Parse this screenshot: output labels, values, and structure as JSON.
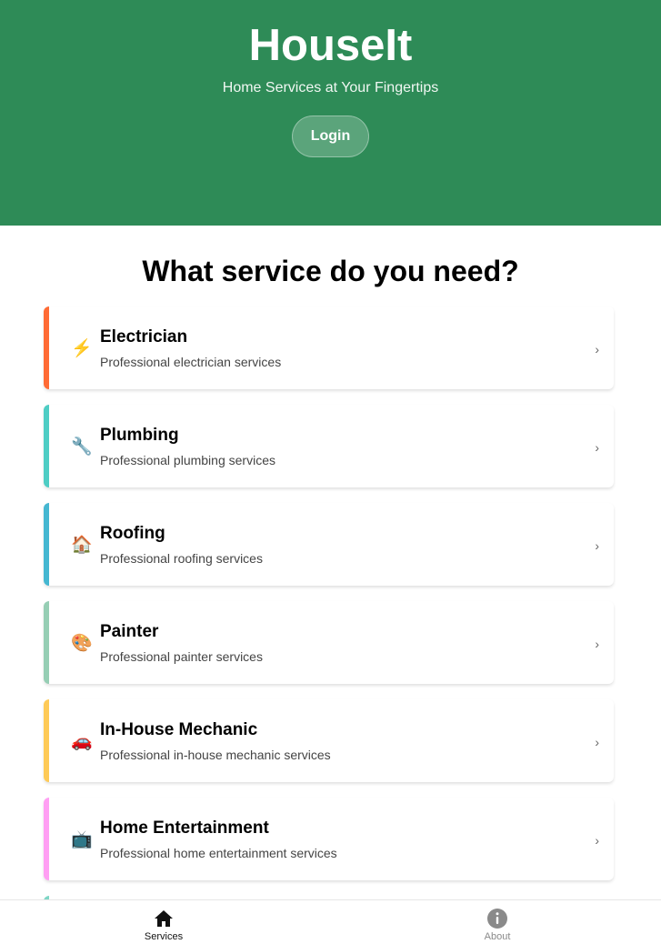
{
  "header": {
    "title": "HouseIt",
    "tagline": "Home Services at Your Fingertips",
    "login_label": "Login"
  },
  "main": {
    "section_title": "What service do you need?",
    "services": [
      {
        "name": "Electrician",
        "description": "Professional electrician services",
        "icon": "⚡",
        "icon_name": "lightning-icon",
        "accent": "#ff6b35"
      },
      {
        "name": "Plumbing",
        "description": "Professional plumbing services",
        "icon": "🔧",
        "icon_name": "wrench-icon",
        "accent": "#4ecdc4"
      },
      {
        "name": "Roofing",
        "description": "Professional roofing services",
        "icon": "🏠",
        "icon_name": "house-icon",
        "accent": "#45b7d1"
      },
      {
        "name": "Painter",
        "description": "Professional painter services",
        "icon": "🎨",
        "icon_name": "palette-icon",
        "accent": "#96ceb4"
      },
      {
        "name": "In-House Mechanic",
        "description": "Professional in-house mechanic services",
        "icon": "🚗",
        "icon_name": "car-icon",
        "accent": "#feca57"
      },
      {
        "name": "Home Entertainment",
        "description": "Professional home entertainment services",
        "icon": "📺",
        "icon_name": "tv-icon",
        "accent": "#ff9ff3"
      }
    ],
    "chevron": "›"
  },
  "tabbar": {
    "services_label": "Services",
    "about_label": "About",
    "active_color": "#111111",
    "inactive_color": "#8a8a8a"
  },
  "colors": {
    "brand": "#2e8b57"
  }
}
